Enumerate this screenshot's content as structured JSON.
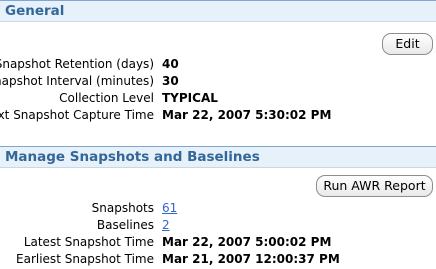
{
  "general": {
    "title": "General",
    "edit_label": "Edit",
    "fields": [
      {
        "label": "Snapshot Retention (days)",
        "value": "40"
      },
      {
        "label": "Snapshot Interval (minutes)",
        "value": "30"
      },
      {
        "label": "Collection Level",
        "value": "TYPICAL"
      },
      {
        "label": "Next Snapshot Capture Time",
        "value": "Mar 22, 2007 5:30:02 PM"
      }
    ]
  },
  "manage": {
    "title": "Manage Snapshots and Baselines",
    "run_awr_label": "Run AWR Report",
    "snapshots": {
      "label": "Snapshots",
      "value": "61"
    },
    "baselines": {
      "label": "Baselines",
      "value": "2"
    },
    "latest": {
      "label": "Latest Snapshot Time",
      "value": "Mar 22, 2007 5:00:02 PM"
    },
    "earliest": {
      "label": "Earliest Snapshot Time",
      "value": "Mar 21, 2007 12:00:37 PM"
    }
  },
  "colors": {
    "header_text": "#336699",
    "header_bg": "#e7f1f9",
    "link": "#3366cc"
  }
}
